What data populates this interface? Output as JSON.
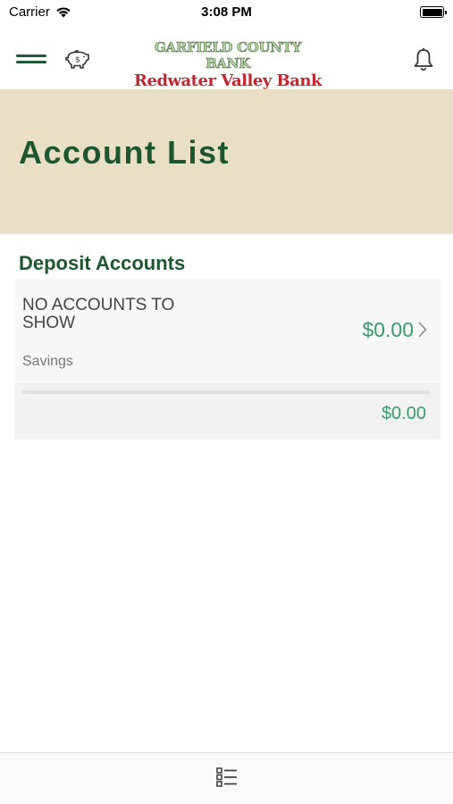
{
  "status_bar": {
    "carrier": "Carrier",
    "time": "3:08 PM"
  },
  "header": {
    "logo_line1": "GARFIELD COUNTY BANK",
    "logo_line2": "Redwater Valley Bank",
    "icons": [
      "menu-icon",
      "piggy-bank-icon",
      "bell-icon"
    ]
  },
  "page": {
    "title": "Account List"
  },
  "deposit_section": {
    "title": "Deposit Accounts",
    "accounts": [
      {
        "name": "NO ACCOUNTS TO SHOW",
        "amount": "$0.00",
        "type": "Savings"
      }
    ],
    "total": "$0.00"
  },
  "tab_bar": {
    "icons": [
      "account-list-icon"
    ]
  },
  "colors": {
    "brand_green": "#1e5631",
    "banner_bg": "#e8dfc6",
    "amount_green": "#3a9a72",
    "logo_red": "#c4262e"
  }
}
